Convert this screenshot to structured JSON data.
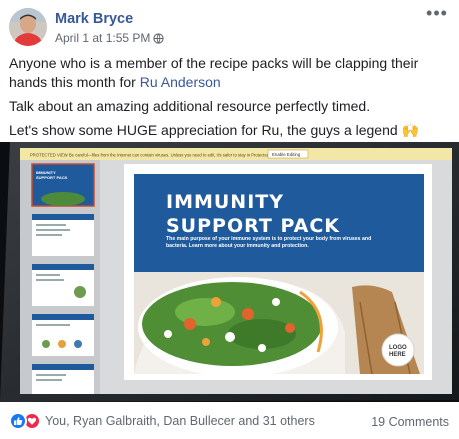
{
  "post": {
    "author": "Mark Bryce",
    "timestamp": "April 1 at 1:55 PM",
    "more_label": "•••",
    "text": {
      "line1_before": "Anyone who is a member of the recipe packs will be clapping their hands this month for ",
      "mention": "Ru Anderson",
      "line2": "Talk about an amazing additional resource perfectly timed.",
      "line3": "Let's show some HUGE appreciation for Ru, the guys a legend 🙌"
    }
  },
  "slide": {
    "title_line1": "IMMUNITY",
    "title_line2": "SUPPORT PACK",
    "body": "The main purpose of your immune system is to protect your body from viruses and bacteria. Learn more about your immunity and protection.",
    "logo_line1": "LOGO",
    "logo_line2": "HERE",
    "banner": "PROTECTED VIEW  Be careful—files from the Internet can contain viruses. Unless you need to edit, it's safer to stay in Protected View.",
    "banner_button": "Enable Editing",
    "thumb_title_line1": "IMMUNITY",
    "thumb_title_line2": "SUPPORT PACK"
  },
  "footer": {
    "reactions_text": "You, Ryan Galbraith, Dan Bullecer and 31 others",
    "comments_text": "19 Comments"
  },
  "colors": {
    "link": "#385898",
    "slide_blue": "#1e5a9c",
    "like": "#1877f2",
    "love": "#f02849"
  }
}
